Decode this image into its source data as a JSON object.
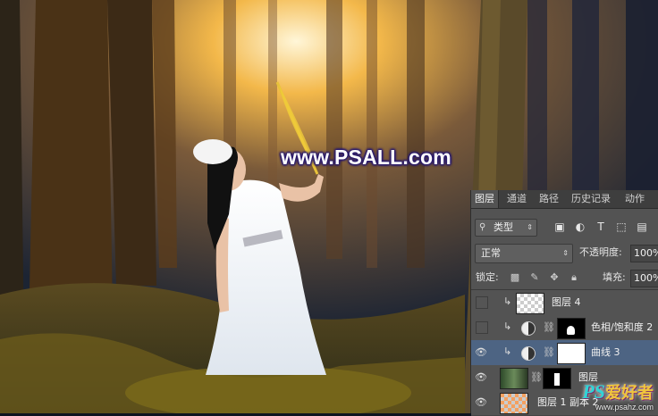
{
  "watermark": "www.PSALL.com",
  "panel": {
    "tabs": [
      "图层",
      "通道",
      "路径",
      "历史记录",
      "动作"
    ],
    "filter_kind": "类型",
    "blend_mode": "正常",
    "opacity_label": "不透明度:",
    "opacity_value": "100%",
    "lock_label": "锁定:",
    "fill_label": "填充:",
    "fill_value": "100%",
    "layers": [
      {
        "name": "图层 4",
        "visible": false,
        "clipped": true,
        "type": "pixel"
      },
      {
        "name": "色相/饱和度 2",
        "visible": false,
        "clipped": true,
        "type": "adjustment"
      },
      {
        "name": "曲线 3",
        "visible": true,
        "clipped": true,
        "type": "adjustment",
        "selected": true
      },
      {
        "name": "图层",
        "visible": true,
        "clipped": false,
        "type": "masked-pixel"
      },
      {
        "name": "图层 1 副本 2",
        "visible": true,
        "clipped": false,
        "type": "pixel"
      }
    ]
  },
  "logo": {
    "text": "PS",
    "text_cn": "爱好者",
    "url": "www.psahz.com"
  },
  "colors": {
    "panel_bg": "#535353",
    "selected_layer": "#4d6483",
    "watermark_outline": "#2a1b6e"
  }
}
